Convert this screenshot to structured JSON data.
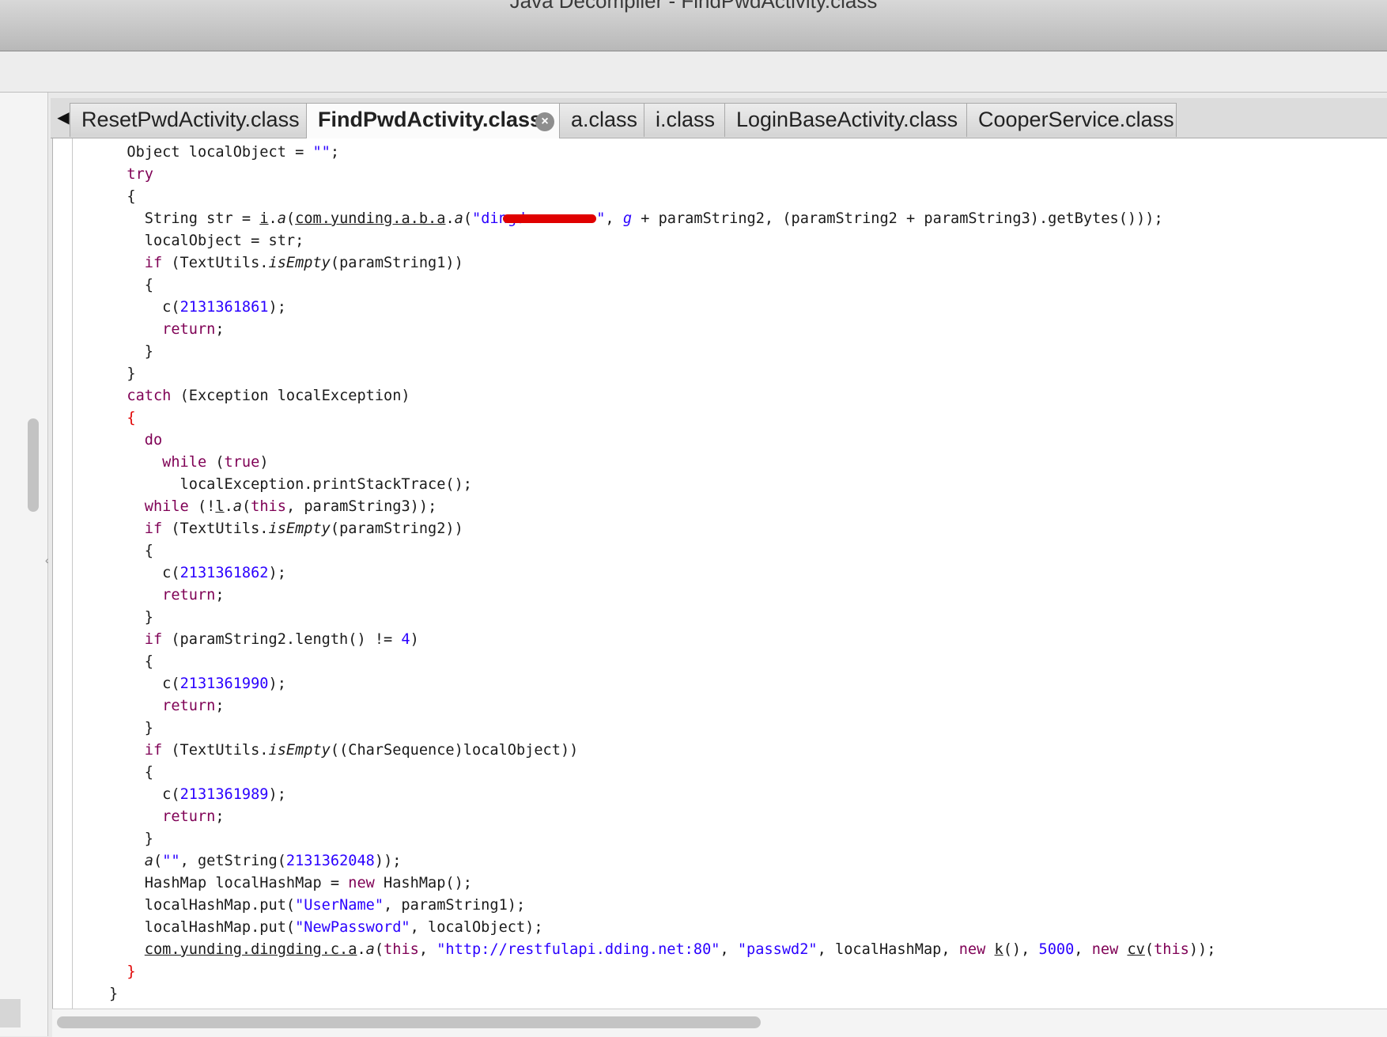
{
  "window": {
    "title": "Java Decompiler - FindPwdActivity.class"
  },
  "tabs": [
    {
      "label": "ResetPwdActivity.class",
      "active": false
    },
    {
      "label": "FindPwdActivity.class",
      "active": true
    },
    {
      "label": "a.class",
      "active": false
    },
    {
      "label": "i.class",
      "active": false
    },
    {
      "label": "LoginBaseActivity.class",
      "active": false
    },
    {
      "label": "CooperService.class",
      "active": false
    }
  ],
  "icons": {
    "tab_scroll_left": "triangle-left-icon",
    "tab_close": "close-circle-icon"
  },
  "code": {
    "s_empty": "\"\"",
    "s_dingding_prefix": "\"dingd",
    "s_dingding_suffix": "\"",
    "s_username": "\"UserName\"",
    "s_newpassword": "\"NewPassword\"",
    "s_url": "\"http://restfulapi.dding.net:80\"",
    "s_passwd2": "\"passwd2\"",
    "n_1": "2131361861",
    "n_2": "2131361862",
    "n_3": "2131361990",
    "n_4": "2131361989",
    "n_5": "2131362048",
    "n_len": "4",
    "n_timeout": "5000"
  },
  "colors": {
    "keyword": "#7f0055",
    "literal": "#2a00ff",
    "brace_highlight": "#e00000",
    "redaction": "#e00000"
  }
}
